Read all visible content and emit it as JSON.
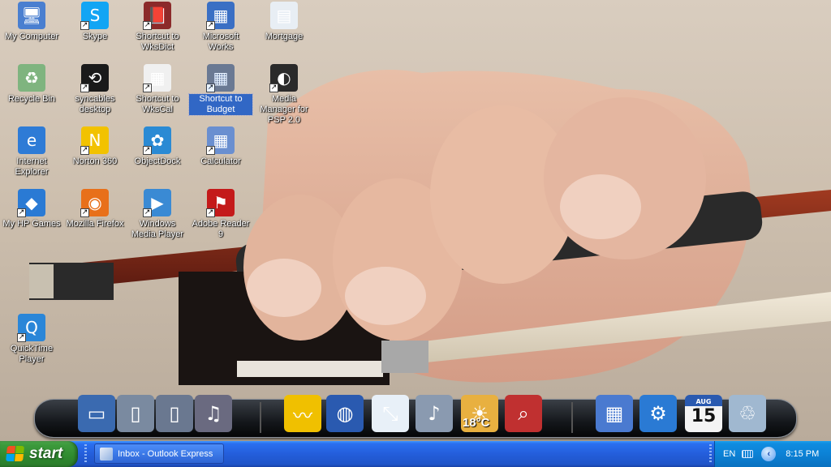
{
  "desktop": {
    "icons": [
      {
        "id": "my-computer",
        "label": "My Computer",
        "color": "#4a7fd0",
        "glyph": "🖥"
      },
      {
        "id": "skype",
        "label": "Skype",
        "color": "#12a5f4",
        "glyph": "S"
      },
      {
        "id": "wksdict",
        "label": "Shortcut to WksDict",
        "color": "#8b2a2a",
        "glyph": "📕"
      },
      {
        "id": "ms-works",
        "label": "Microsoft Works",
        "color": "#3a6fc4",
        "glyph": "▦"
      },
      {
        "id": "mortgage",
        "label": "Mortgage",
        "color": "#e8eef4",
        "glyph": "▤"
      },
      {
        "id": "recycle-bin",
        "label": "Recycle Bin",
        "color": "#7fb47f",
        "glyph": "♻"
      },
      {
        "id": "syncables",
        "label": "syncables desktop",
        "color": "#1a1a1a",
        "glyph": "⟲"
      },
      {
        "id": "wkscal",
        "label": "Shortcut to WksCal",
        "color": "#f0f0f0",
        "glyph": "▦"
      },
      {
        "id": "budget",
        "label": "Shortcut to Budget",
        "color": "#4a7fd0",
        "glyph": "▦"
      },
      {
        "id": "media-manager",
        "label": "Media Manager for PSP 2.0",
        "color": "#2a2a2a",
        "glyph": "◐"
      },
      {
        "id": "ie",
        "label": "Internet Explorer",
        "color": "#2e7bd6",
        "glyph": "e"
      },
      {
        "id": "norton",
        "label": "Norton 360",
        "color": "#f2c200",
        "glyph": "N"
      },
      {
        "id": "objectdock",
        "label": "ObjectDock",
        "color": "#2a8ad4",
        "glyph": "✿"
      },
      {
        "id": "calculator",
        "label": "Calculator",
        "color": "#6a8fd0",
        "glyph": "▦"
      },
      {
        "id": "hp-games",
        "label": "My HP Games",
        "color": "#2a7ad4",
        "glyph": "◆"
      },
      {
        "id": "firefox",
        "label": "Mozilla Firefox",
        "color": "#e8701a",
        "glyph": "◉"
      },
      {
        "id": "wmp",
        "label": "Windows Media Player",
        "color": "#3a8ad4",
        "glyph": "▶"
      },
      {
        "id": "adobe-reader",
        "label": "Adobe Reader 9",
        "color": "#c41a1a",
        "glyph": "⚑"
      },
      {
        "id": "quicktime",
        "label": "QuickTime Player",
        "color": "#2a86d8",
        "glyph": "Q"
      }
    ]
  },
  "dock": {
    "items": [
      {
        "id": "desktop",
        "color": "#3a6ab0",
        "glyph": "▭"
      },
      {
        "id": "documents",
        "color": "#7a8aa0",
        "glyph": "▯"
      },
      {
        "id": "pictures",
        "color": "#6a7890",
        "glyph": "▯"
      },
      {
        "id": "music",
        "color": "#6a6a80",
        "glyph": "♫"
      },
      {
        "id": "activity-monitor",
        "color": "#f0c000",
        "glyph": "〰"
      },
      {
        "id": "network",
        "color": "#2a5ab0",
        "glyph": "◍"
      },
      {
        "id": "resize",
        "color": "#e8f0f8",
        "glyph": "⤡"
      },
      {
        "id": "audio",
        "color": "#8a9ab0",
        "glyph": "♪"
      },
      {
        "id": "weather",
        "color": "#e8b040",
        "glyph": "☀",
        "temperature": "18°C"
      },
      {
        "id": "search",
        "color": "#c03030",
        "glyph": "⌕"
      },
      {
        "id": "calculator",
        "color": "#4a7ad0",
        "glyph": "▦"
      },
      {
        "id": "settings",
        "color": "#2a7ad4",
        "glyph": "⚙"
      },
      {
        "id": "calendar",
        "color": "#2a5ab0",
        "month": "AUG",
        "day": "15"
      },
      {
        "id": "recycle",
        "color": "#a0b8d0",
        "glyph": "♲"
      }
    ]
  },
  "taskbar": {
    "start_label": "start",
    "tasks": [
      {
        "label": "Inbox - Outlook Express"
      }
    ],
    "tray": {
      "language": "EN",
      "clock": "8:15 PM"
    }
  }
}
